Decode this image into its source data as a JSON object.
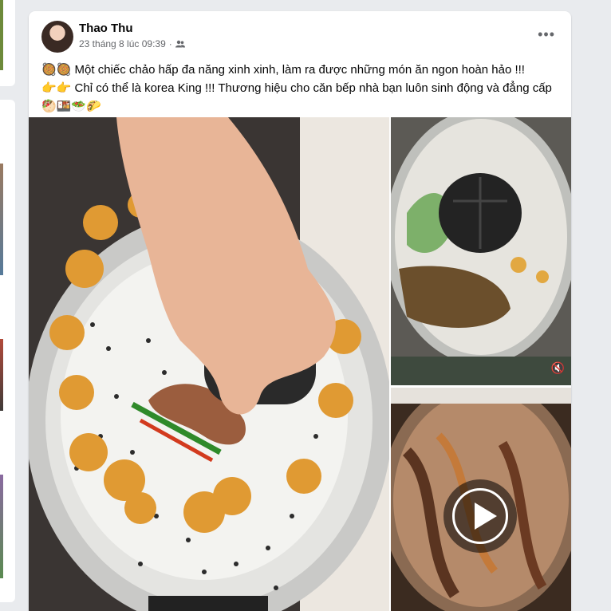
{
  "post": {
    "author": "Thao Thu",
    "timestamp": "23 tháng 8 lúc 09:39",
    "audience_icon": "friends-icon",
    "more_label": "•••",
    "text_lines": [
      {
        "emoji": "🥘🥘",
        "text": "Một chiếc chảo hấp đa năng xinh xinh, làm ra được những món ăn ngon hoàn hảo !!!"
      },
      {
        "emoji": "👉👉",
        "text": "Chỉ có thể là korea King !!! Thương hiệu cho căn bếp nhà bạn luôn sinh động và đẳng cấp"
      },
      {
        "emoji": "🥙🍱🥗🌮",
        "text": ""
      }
    ]
  },
  "media": {
    "items": [
      {
        "name": "steamer-pot-photo"
      },
      {
        "name": "steamer-lid-photo"
      },
      {
        "name": "steamer-video",
        "control": "play-icon"
      }
    ],
    "mute_glyph": "🔇"
  }
}
